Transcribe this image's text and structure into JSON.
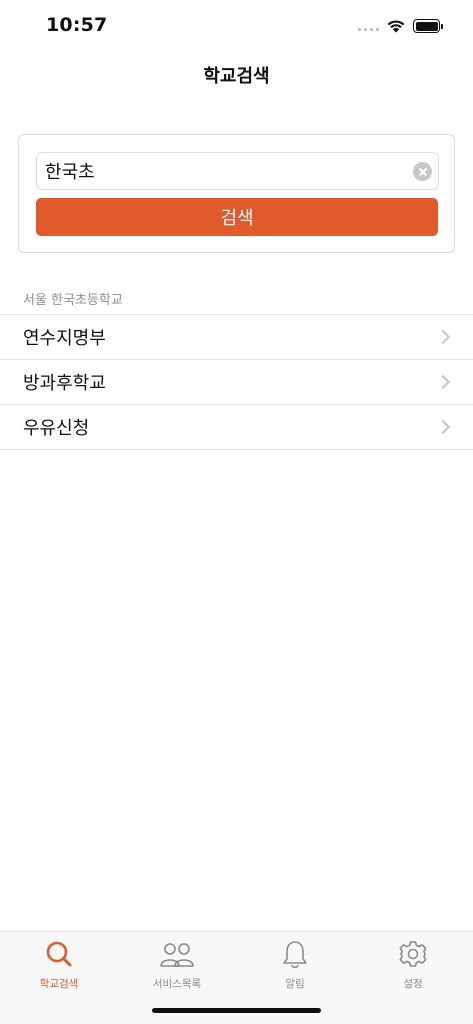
{
  "status_bar": {
    "time": "10:57"
  },
  "nav": {
    "title": "학교검색"
  },
  "search": {
    "value": "한국초",
    "placeholder": "",
    "button_label": "검색"
  },
  "results": {
    "section_title": "서울 한국초등학교",
    "items": [
      {
        "label": "연수지명부"
      },
      {
        "label": "방과후학교"
      },
      {
        "label": "우유신청"
      }
    ]
  },
  "tab_bar": {
    "tabs": [
      {
        "label": "학교검색",
        "icon": "search-icon",
        "active": true
      },
      {
        "label": "서비스목록",
        "icon": "people-icon",
        "active": false
      },
      {
        "label": "알림",
        "icon": "bell-icon",
        "active": false
      },
      {
        "label": "설정",
        "icon": "gear-icon",
        "active": false
      }
    ]
  },
  "colors": {
    "accent": "#e05a2b",
    "inactive": "#8a8a8e",
    "separator": "#e4e4e4"
  }
}
